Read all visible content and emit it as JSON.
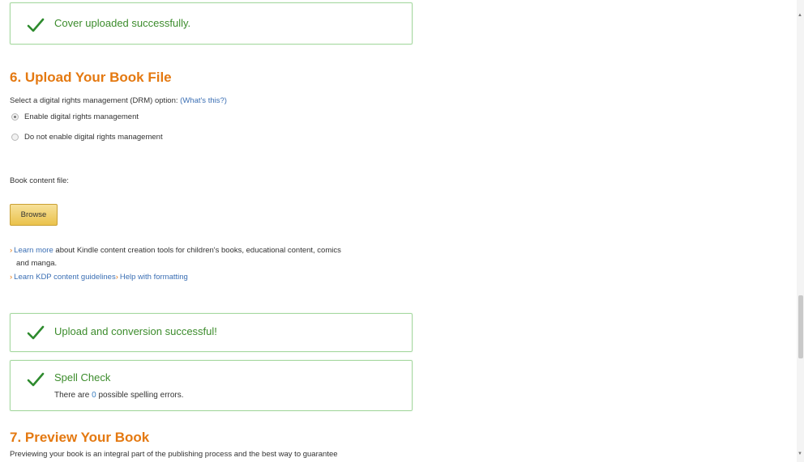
{
  "cover_success": {
    "message": "Cover uploaded successfully."
  },
  "section6": {
    "title": "6. Upload Your Book File",
    "drm_prompt": "Select a digital rights management (DRM) option:",
    "drm_help_link": "(What's this?)",
    "drm_options": [
      {
        "label": "Enable digital rights management",
        "selected": true
      },
      {
        "label": "Do not enable digital rights management",
        "selected": false
      }
    ],
    "content_file_label": "Book content file:",
    "browse_label": "Browse",
    "links": {
      "learn_more_link": "Learn more",
      "learn_more_text_1": " about Kindle content creation tools for children's books, educational content, comics",
      "learn_more_text_2": "and manga.",
      "guidelines_link": "Learn KDP content guidelines",
      "formatting_link": "Help with formatting"
    }
  },
  "upload_success": {
    "message": "Upload and conversion successful!"
  },
  "spell_check": {
    "title": "Spell Check",
    "detail_prefix": "There are ",
    "error_count": "0",
    "detail_suffix": " possible spelling errors."
  },
  "section7": {
    "title": "7. Preview Your Book",
    "intro": "Previewing your book is an integral part of the publishing process and the best way to guarantee"
  },
  "colors": {
    "section_title": "#e47911",
    "success_green": "#3c8c2c",
    "link_blue": "#3b6fb4",
    "button_yellow": "#eac24b"
  },
  "icons": [
    "check-icon",
    "radio-selected",
    "radio-unselected",
    "bullet-icon"
  ]
}
